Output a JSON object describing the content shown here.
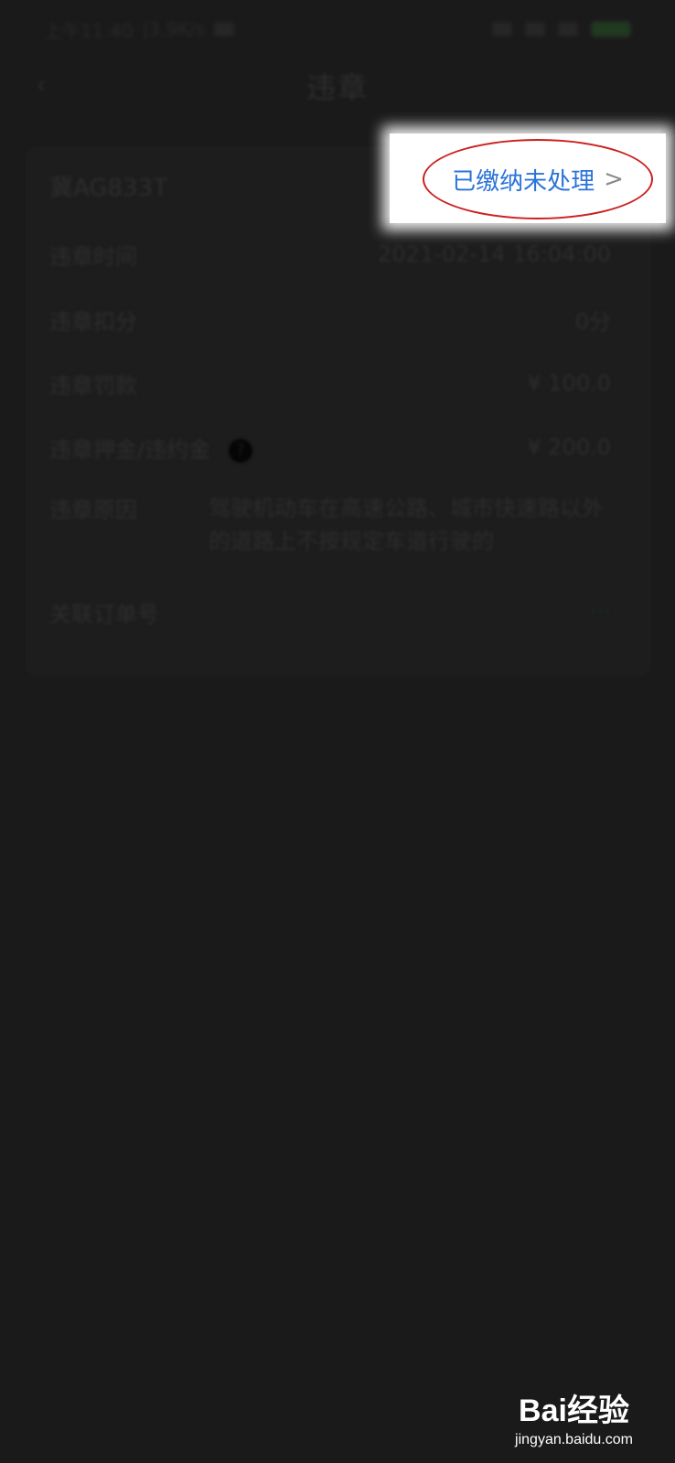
{
  "status_bar": {
    "time": "上午11:40",
    "speed": "|3.9K/s"
  },
  "nav": {
    "title": "违章"
  },
  "violation": {
    "plate": "冀AG833T",
    "status_label": "已缴纳未处理",
    "rows": {
      "time_label": "违章时间",
      "time_value": "2021-02-14 16:04:00",
      "points_label": "违章扣分",
      "points_value": "0分",
      "fine_label": "违章罚款",
      "fine_value": "¥ 100.0",
      "deposit_label": "违章押金/违约金",
      "deposit_value": "¥ 200.0",
      "reason_label": "违章原因",
      "reason_value": "驾驶机动车在高速公路、城市快速路以外的道路上不按规定车道行驶的",
      "order_label": "关联订单号",
      "order_value": "···"
    }
  },
  "watermark": {
    "brand": "Bai经验",
    "domain": "jingyan.baidu.com"
  }
}
